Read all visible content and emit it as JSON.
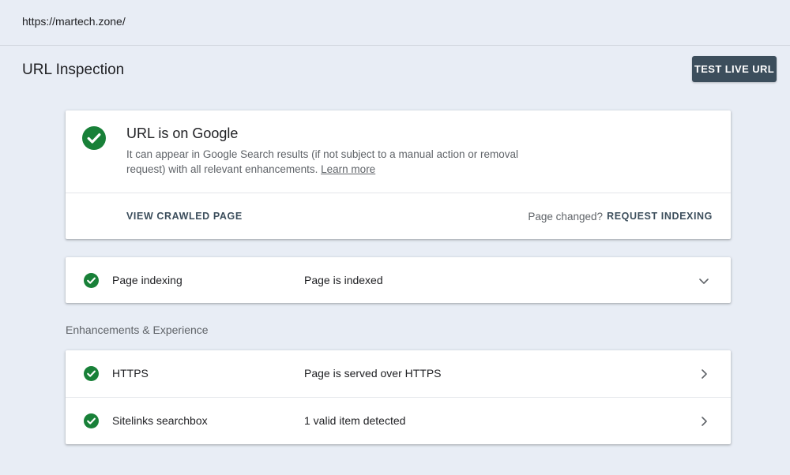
{
  "topbar": {
    "url": "https://martech.zone/"
  },
  "header": {
    "title": "URL Inspection",
    "test_live_label": "TEST LIVE URL"
  },
  "status": {
    "title": "URL is on Google",
    "description": "It can appear in Google Search results (if not subject to a manual action or removal request) with all relevant enhancements.",
    "learn_more": "Learn more",
    "view_crawled": "VIEW CRAWLED PAGE",
    "page_changed": "Page changed?",
    "request_indexing": "REQUEST INDEXING"
  },
  "indexing": {
    "label": "Page indexing",
    "value": "Page is indexed"
  },
  "enhancements": {
    "section_label": "Enhancements & Experience",
    "items": [
      {
        "label": "HTTPS",
        "value": "Page is served over HTTPS"
      },
      {
        "label": "Sitelinks searchbox",
        "value": "1 valid item detected"
      }
    ]
  },
  "colors": {
    "accent": "#3c4e5c",
    "success": "#188038",
    "background": "#e8edf5"
  },
  "icons": {
    "status": "check-circle-icon",
    "expand": "chevron-down-icon",
    "navigate": "chevron-right-icon"
  }
}
